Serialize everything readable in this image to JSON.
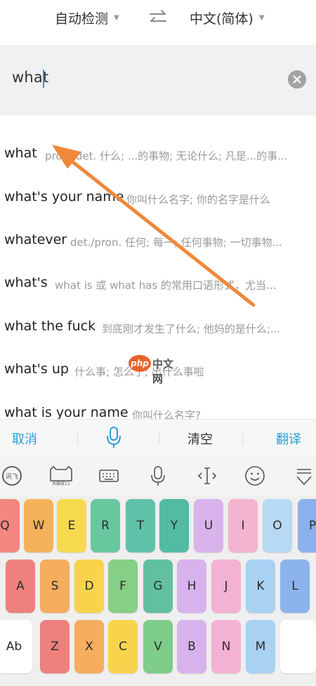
{
  "lang_bar": {
    "source_lang": "自动检测",
    "target_lang": "中文(简体)"
  },
  "input": {
    "value": "what"
  },
  "suggestions": [
    {
      "word": "what",
      "definition": "pron./det. 什么; ...的事物; 无论什么; 凡是...的事..."
    },
    {
      "word": "what's your name",
      "definition": "你叫什么名字; 你的名字是什么"
    },
    {
      "word": "whatever",
      "definition": "det./pron. 任何; 每一; 任何事物; 一切事物..."
    },
    {
      "word": "what's",
      "definition": "what is 或 what has 的常用口语形式，尤当..."
    },
    {
      "word": "what the fuck",
      "definition": "到底刚才发生了什么; 他妈的是什么;..."
    },
    {
      "word": "what's up",
      "definition": "什么事; 怎么了; 出什么事啦"
    },
    {
      "word": "what is your name",
      "definition": "你叫什么名字?"
    }
  ],
  "watermark": {
    "logo_text": "php",
    "site_text": "中文网"
  },
  "action_bar": {
    "cancel": "取消",
    "clear": "清空",
    "translate": "翻译"
  },
  "toolbar": {
    "logo_text": "讯飞",
    "skin_label": "天猫双11",
    "icons": [
      "ifly-logo-icon",
      "tmall-icon",
      "keyboard-icon",
      "microphone-icon",
      "cursor-move-icon",
      "emoji-icon",
      "hide-keyboard-icon"
    ]
  },
  "keyboard": {
    "row1": [
      "Q",
      "W",
      "E",
      "R",
      "T",
      "Y",
      "U",
      "I",
      "O",
      "P"
    ],
    "row2": [
      "A",
      "S",
      "D",
      "F",
      "G",
      "H",
      "J",
      "K",
      "L"
    ],
    "row3_mode": "Ab",
    "row3": [
      "Z",
      "X",
      "C",
      "V",
      "B",
      "N",
      "M"
    ]
  },
  "colors": {
    "accent_blue": "#2a9fd6",
    "arrow_orange": "#f0883a"
  }
}
